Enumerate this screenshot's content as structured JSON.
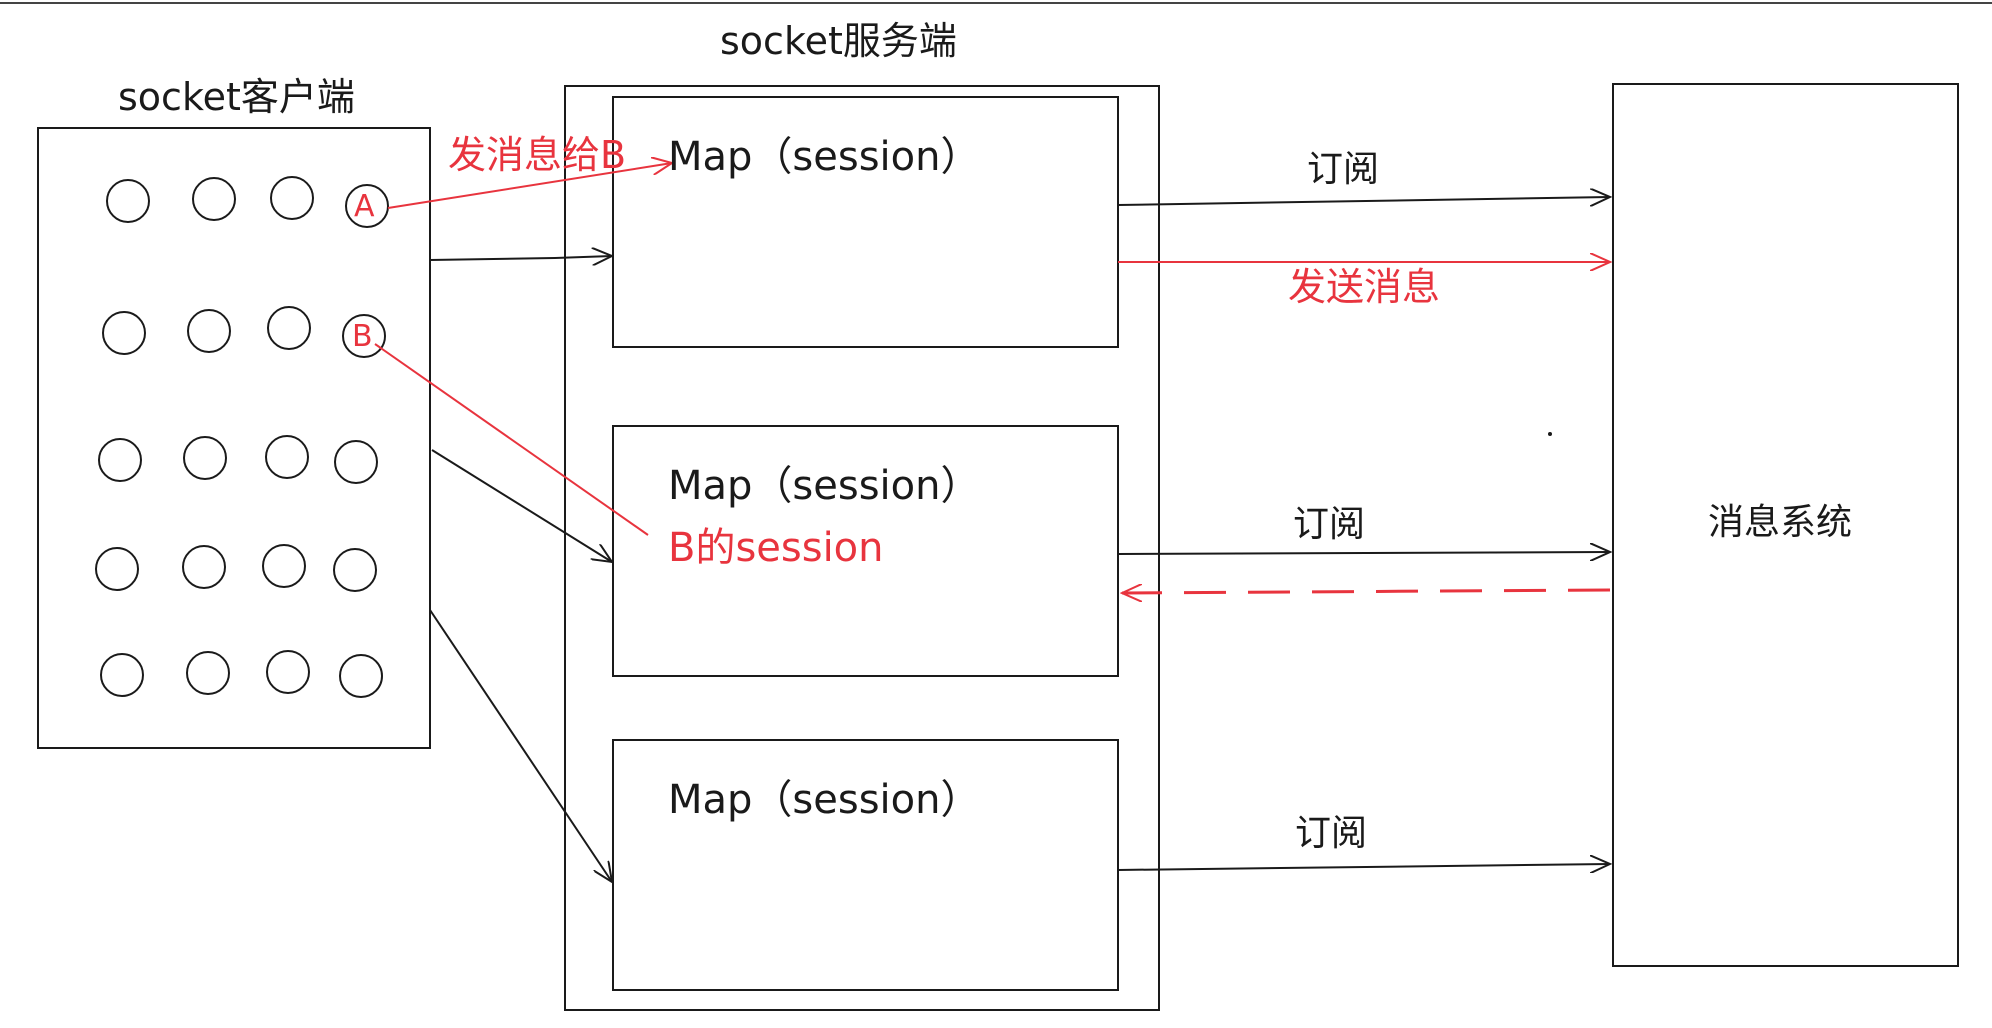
{
  "client": {
    "title": "socket客户端",
    "marker_a": "A",
    "marker_b": "B"
  },
  "server": {
    "title": "socket服务端",
    "maps": [
      {
        "label": "Map（session）",
        "note": ""
      },
      {
        "label": "Map（session）",
        "note": "B的session"
      },
      {
        "label": "Map（session）",
        "note": ""
      }
    ]
  },
  "message_system": {
    "title": "消息系统"
  },
  "edges": {
    "send_to_b": "发消息给B",
    "subscribe": [
      "订阅",
      "订阅",
      "订阅"
    ],
    "publish": "发送消息"
  },
  "colors": {
    "ink": "#1a1a1a",
    "accent": "#e8343e"
  }
}
